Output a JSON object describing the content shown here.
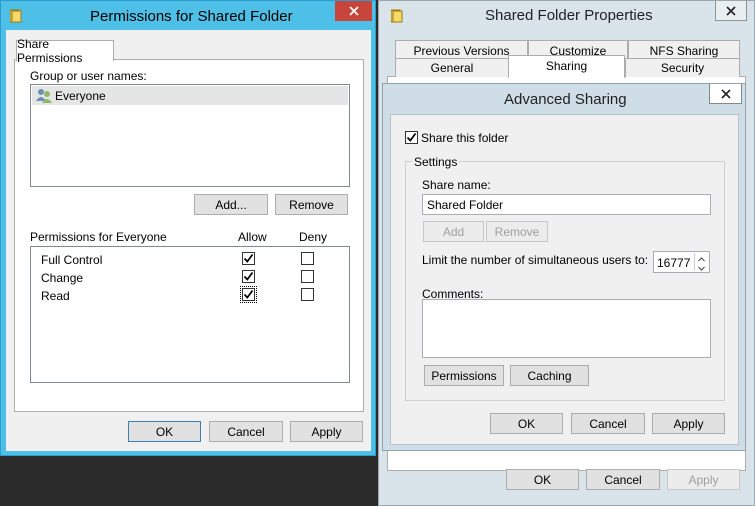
{
  "permissions_window": {
    "title": "Permissions for Shared Folder",
    "tab_label": "Share Permissions",
    "group_label": "Group or user names:",
    "users": [
      {
        "name": "Everyone"
      }
    ],
    "add_label": "Add...",
    "remove_label": "Remove",
    "perm_header": "Permissions for Everyone",
    "allow_header": "Allow",
    "deny_header": "Deny",
    "permissions": [
      {
        "name": "Full Control",
        "allow": true,
        "deny": false
      },
      {
        "name": "Change",
        "allow": true,
        "deny": false
      },
      {
        "name": "Read",
        "allow": true,
        "deny": false
      }
    ],
    "ok_label": "OK",
    "cancel_label": "Cancel",
    "apply_label": "Apply",
    "accent_color": "#4ebfe6"
  },
  "properties_window": {
    "title": "Shared Folder Properties",
    "tabs_row1": [
      "Previous Versions",
      "Customize",
      "NFS Sharing"
    ],
    "tabs_row2": [
      "General",
      "Sharing",
      "Security"
    ],
    "active_tab": "Sharing",
    "ok_label": "OK",
    "cancel_label": "Cancel",
    "apply_label": "Apply"
  },
  "advanced_sharing": {
    "title": "Advanced Sharing",
    "share_checkbox_label": "Share this folder",
    "share_checked": true,
    "settings_label": "Settings",
    "share_name_label": "Share name:",
    "share_name_value": "Shared Folder",
    "add_label": "Add",
    "remove_label": "Remove",
    "limit_label": "Limit the number of simultaneous users to:",
    "limit_value": "16777",
    "comments_label": "Comments:",
    "comments_value": "",
    "permissions_label": "Permissions",
    "caching_label": "Caching",
    "ok_label": "OK",
    "cancel_label": "Cancel",
    "apply_label": "Apply"
  }
}
